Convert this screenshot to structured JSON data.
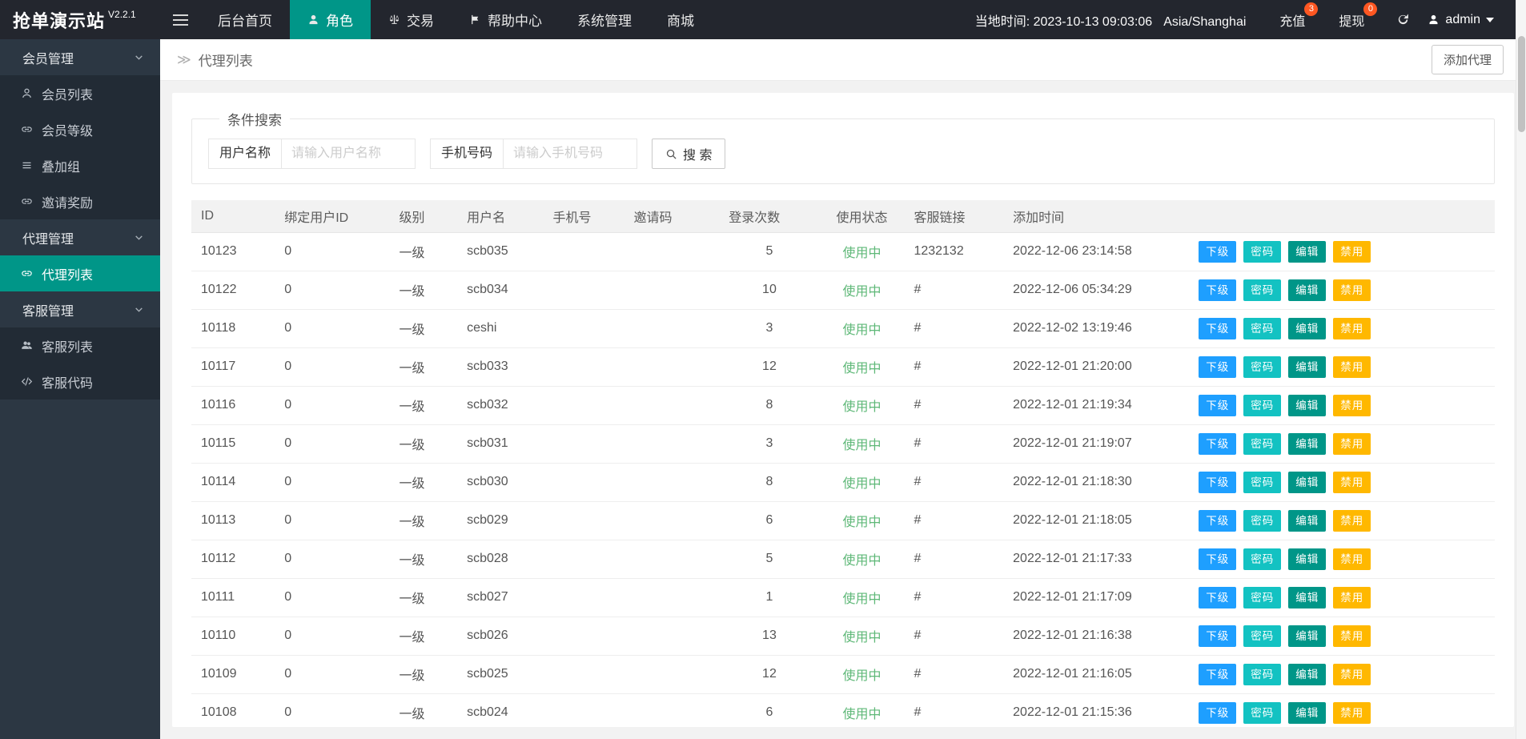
{
  "app": {
    "title": "抢单演示站",
    "version": "V2.2.1"
  },
  "colors": {
    "accent": "#009688",
    "status_green": "#5FB878",
    "badge_red": "#FF5722"
  },
  "header": {
    "time": "当地时间: 2023-10-13 09:03:06",
    "timezone": "Asia/Shanghai",
    "nav": [
      {
        "label": "后台首页"
      },
      {
        "label": "角色",
        "icon": "person-icon",
        "active": true
      },
      {
        "label": "交易",
        "icon": "scale-icon"
      },
      {
        "label": "帮助中心",
        "icon": "flag-icon"
      },
      {
        "label": "系统管理"
      },
      {
        "label": "商城"
      }
    ],
    "recharge_label": "充值",
    "recharge_badge": "3",
    "withdraw_label": "提现",
    "withdraw_badge": "0",
    "username": "admin"
  },
  "sidebar": {
    "sections": [
      {
        "label": "会员管理",
        "items": [
          {
            "label": "会员列表",
            "icon": "user-icon"
          },
          {
            "label": "会员等级",
            "icon": "link-icon"
          },
          {
            "label": "叠加组",
            "icon": "list-icon"
          },
          {
            "label": "邀请奖励",
            "icon": "link-icon"
          }
        ]
      },
      {
        "label": "代理管理",
        "items": [
          {
            "label": "代理列表",
            "icon": "link-icon",
            "active": true
          }
        ]
      },
      {
        "label": "客服管理",
        "items": [
          {
            "label": "客服列表",
            "icon": "users-icon"
          },
          {
            "label": "客服代码",
            "icon": "code-icon"
          }
        ]
      }
    ]
  },
  "breadcrumb": {
    "icon": "≫",
    "title": "代理列表",
    "add_button": "添加代理"
  },
  "search": {
    "legend": "条件搜索",
    "username_label": "用户名称",
    "username_placeholder": "请输入用户名称",
    "phone_label": "手机号码",
    "phone_placeholder": "请输入手机号码",
    "button_label": "搜 索"
  },
  "table": {
    "columns": [
      "ID",
      "绑定用户ID",
      "级别",
      "用户名",
      "手机号",
      "邀请码",
      "登录次数",
      "使用状态",
      "客服链接",
      "添加时间",
      ""
    ],
    "actions": [
      {
        "name": "subordinate-button",
        "label": "下级",
        "color": "#1E9FFF"
      },
      {
        "name": "password-button",
        "label": "密码",
        "color": "#13C2C2"
      },
      {
        "name": "edit-button",
        "label": "编辑",
        "color": "#009688"
      },
      {
        "name": "disable-button",
        "label": "禁用",
        "color": "#FFB800"
      }
    ],
    "rows": [
      {
        "id": "10123",
        "bind_user_id": "0",
        "level": "一级",
        "username": "scb035",
        "phone": "",
        "invite_code": "",
        "login_count": "5",
        "status": "使用中",
        "service_link": "1232132",
        "created_at": "2022-12-06 23:14:58"
      },
      {
        "id": "10122",
        "bind_user_id": "0",
        "level": "一级",
        "username": "scb034",
        "phone": "",
        "invite_code": "",
        "login_count": "10",
        "status": "使用中",
        "service_link": "#",
        "created_at": "2022-12-06 05:34:29"
      },
      {
        "id": "10118",
        "bind_user_id": "0",
        "level": "一级",
        "username": "ceshi",
        "phone": "",
        "invite_code": "",
        "login_count": "3",
        "status": "使用中",
        "service_link": "#",
        "created_at": "2022-12-02 13:19:46"
      },
      {
        "id": "10117",
        "bind_user_id": "0",
        "level": "一级",
        "username": "scb033",
        "phone": "",
        "invite_code": "",
        "login_count": "12",
        "status": "使用中",
        "service_link": "#",
        "created_at": "2022-12-01 21:20:00"
      },
      {
        "id": "10116",
        "bind_user_id": "0",
        "level": "一级",
        "username": "scb032",
        "phone": "",
        "invite_code": "",
        "login_count": "8",
        "status": "使用中",
        "service_link": "#",
        "created_at": "2022-12-01 21:19:34"
      },
      {
        "id": "10115",
        "bind_user_id": "0",
        "level": "一级",
        "username": "scb031",
        "phone": "",
        "invite_code": "",
        "login_count": "3",
        "status": "使用中",
        "service_link": "#",
        "created_at": "2022-12-01 21:19:07"
      },
      {
        "id": "10114",
        "bind_user_id": "0",
        "level": "一级",
        "username": "scb030",
        "phone": "",
        "invite_code": "",
        "login_count": "8",
        "status": "使用中",
        "service_link": "#",
        "created_at": "2022-12-01 21:18:30"
      },
      {
        "id": "10113",
        "bind_user_id": "0",
        "level": "一级",
        "username": "scb029",
        "phone": "",
        "invite_code": "",
        "login_count": "6",
        "status": "使用中",
        "service_link": "#",
        "created_at": "2022-12-01 21:18:05"
      },
      {
        "id": "10112",
        "bind_user_id": "0",
        "level": "一级",
        "username": "scb028",
        "phone": "",
        "invite_code": "",
        "login_count": "5",
        "status": "使用中",
        "service_link": "#",
        "created_at": "2022-12-01 21:17:33"
      },
      {
        "id": "10111",
        "bind_user_id": "0",
        "level": "一级",
        "username": "scb027",
        "phone": "",
        "invite_code": "",
        "login_count": "1",
        "status": "使用中",
        "service_link": "#",
        "created_at": "2022-12-01 21:17:09"
      },
      {
        "id": "10110",
        "bind_user_id": "0",
        "level": "一级",
        "username": "scb026",
        "phone": "",
        "invite_code": "",
        "login_count": "13",
        "status": "使用中",
        "service_link": "#",
        "created_at": "2022-12-01 21:16:38"
      },
      {
        "id": "10109",
        "bind_user_id": "0",
        "level": "一级",
        "username": "scb025",
        "phone": "",
        "invite_code": "",
        "login_count": "12",
        "status": "使用中",
        "service_link": "#",
        "created_at": "2022-12-01 21:16:05"
      },
      {
        "id": "10108",
        "bind_user_id": "0",
        "level": "一级",
        "username": "scb024",
        "phone": "",
        "invite_code": "",
        "login_count": "6",
        "status": "使用中",
        "service_link": "#",
        "created_at": "2022-12-01 21:15:36"
      }
    ]
  }
}
